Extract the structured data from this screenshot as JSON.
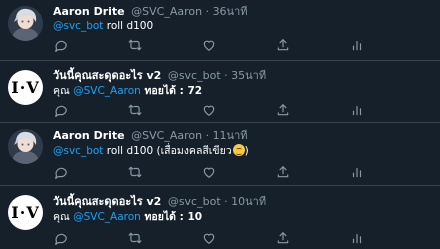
{
  "tweets": [
    {
      "avatar": "anime-character-avatar",
      "name": "Aaron Drite",
      "handle": "@SVC_Aaron",
      "dot": "·",
      "time": "36นาที",
      "reply_to": "@svc_bot",
      "text": " roll d100",
      "suffix": ""
    },
    {
      "avatar": "bot-logo-avatar",
      "avatar_text": "I·V",
      "name": "วันนี้คุณสะดุดอะไร v2",
      "handle": "@svc_bot",
      "dot": "·",
      "time": "35นาที",
      "prefix": "คุณ ",
      "mention": "@SVC_Aaron",
      "result_label": " ทอยได้ : ",
      "result": "72"
    },
    {
      "avatar": "anime-character-avatar",
      "name": "Aaron Drite",
      "handle": "@SVC_Aaron",
      "dot": "·",
      "time": "11นาที",
      "reply_to": "@svc_bot",
      "text": " roll d100 (เสื่อมงคลสีเขียว",
      "suffix": ")",
      "emoji": "smiling-face-emoji"
    },
    {
      "avatar": "bot-logo-avatar",
      "avatar_text": "I·V",
      "name": "วันนี้คุณสะดุดอะไร v2",
      "handle": "@svc_bot",
      "dot": "·",
      "time": "10นาที",
      "prefix": "คุณ ",
      "mention": "@SVC_Aaron",
      "result_label": " ทอยได้ : ",
      "result": "10"
    }
  ],
  "action_icons": [
    "reply-icon",
    "retweet-icon",
    "like-icon",
    "share-icon",
    "analytics-icon"
  ],
  "colors": {
    "background": "#15202b",
    "divider": "#38444d",
    "muted": "#8899a6",
    "accent": "#1da1f2",
    "text": "#ffffff"
  }
}
